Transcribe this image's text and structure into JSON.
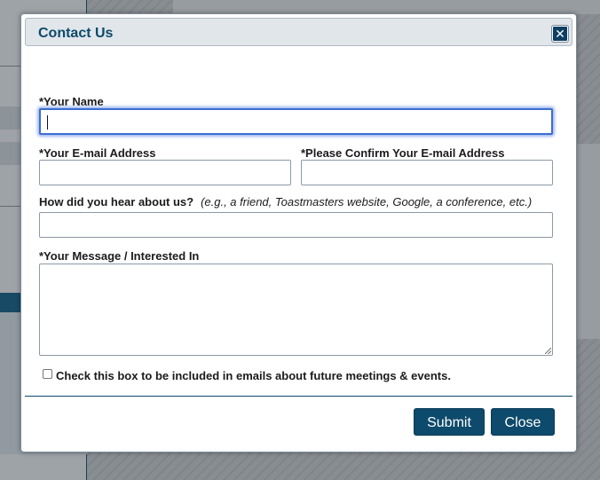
{
  "dialog": {
    "title": "Contact Us",
    "close_icon": "close-icon"
  },
  "form": {
    "name_label": "*Your Name",
    "name_value": "",
    "email_label": "*Your E-mail Address",
    "email_value": "",
    "confirm_email_label": "*Please Confirm Your E-mail Address",
    "confirm_email_value": "",
    "referral_label": "How did you hear about us?",
    "referral_hint": "(e.g., a friend, Toastmasters website, Google, a conference, etc.)",
    "referral_value": "",
    "message_label": "*Your Message / Interested In",
    "message_value": "",
    "opt_in_label": "Check this box to be included in emails about future meetings & events.",
    "opt_in_checked": false
  },
  "buttons": {
    "submit": "Submit",
    "close": "Close"
  },
  "colors": {
    "accent": "#0d4a6b",
    "focus_ring": "#3c6ed1"
  }
}
